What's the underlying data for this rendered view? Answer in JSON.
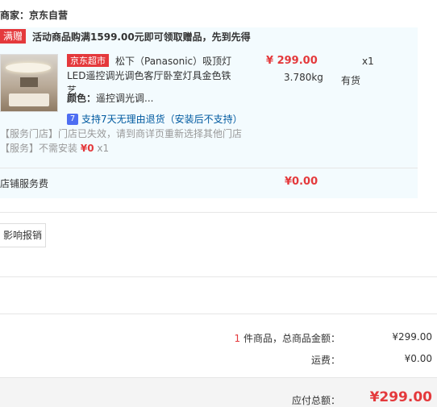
{
  "shop": {
    "label": "商家：京东自营"
  },
  "promo": {
    "tag": "满赠",
    "text": "活动商品购满1599.00元即可领取赠品，先到先得"
  },
  "product": {
    "store_tag": "京东超市",
    "name_line1": "松下（Panasonic）吸顶灯",
    "name_line2": "LED遥控调光调色客厅卧室灯具金色铁艺",
    "price": "¥ 299.00",
    "qty": "x1",
    "weight": "3.780kg",
    "stock": "有货",
    "color_label": "颜色：",
    "color_value": "遥控调光调...",
    "return_icon": "7",
    "return_text": "支持7天无理由退货（安装后不支持）",
    "service_store": "【服务门店】门店已失效，请到商详页重新选择其他门店",
    "service_install_prefix": "【服务】不需安装",
    "service_install_price": "¥0",
    "service_install_qty": "x1"
  },
  "shop_fee": {
    "label": "店铺服务费",
    "value": "¥0.00"
  },
  "invoice": {
    "button": "影响报销"
  },
  "summary": {
    "count": "1",
    "count_suffix": "件商品，总商品金额：",
    "goods_total": "¥299.00",
    "shipping_label": "运费：",
    "shipping_value": "¥0.00",
    "total_label": "应付总额：",
    "total_value": "¥299.00"
  },
  "colors": {
    "accent": "#e4393c",
    "promo_bg": "#f3fbfe",
    "link": "#005aa0"
  }
}
